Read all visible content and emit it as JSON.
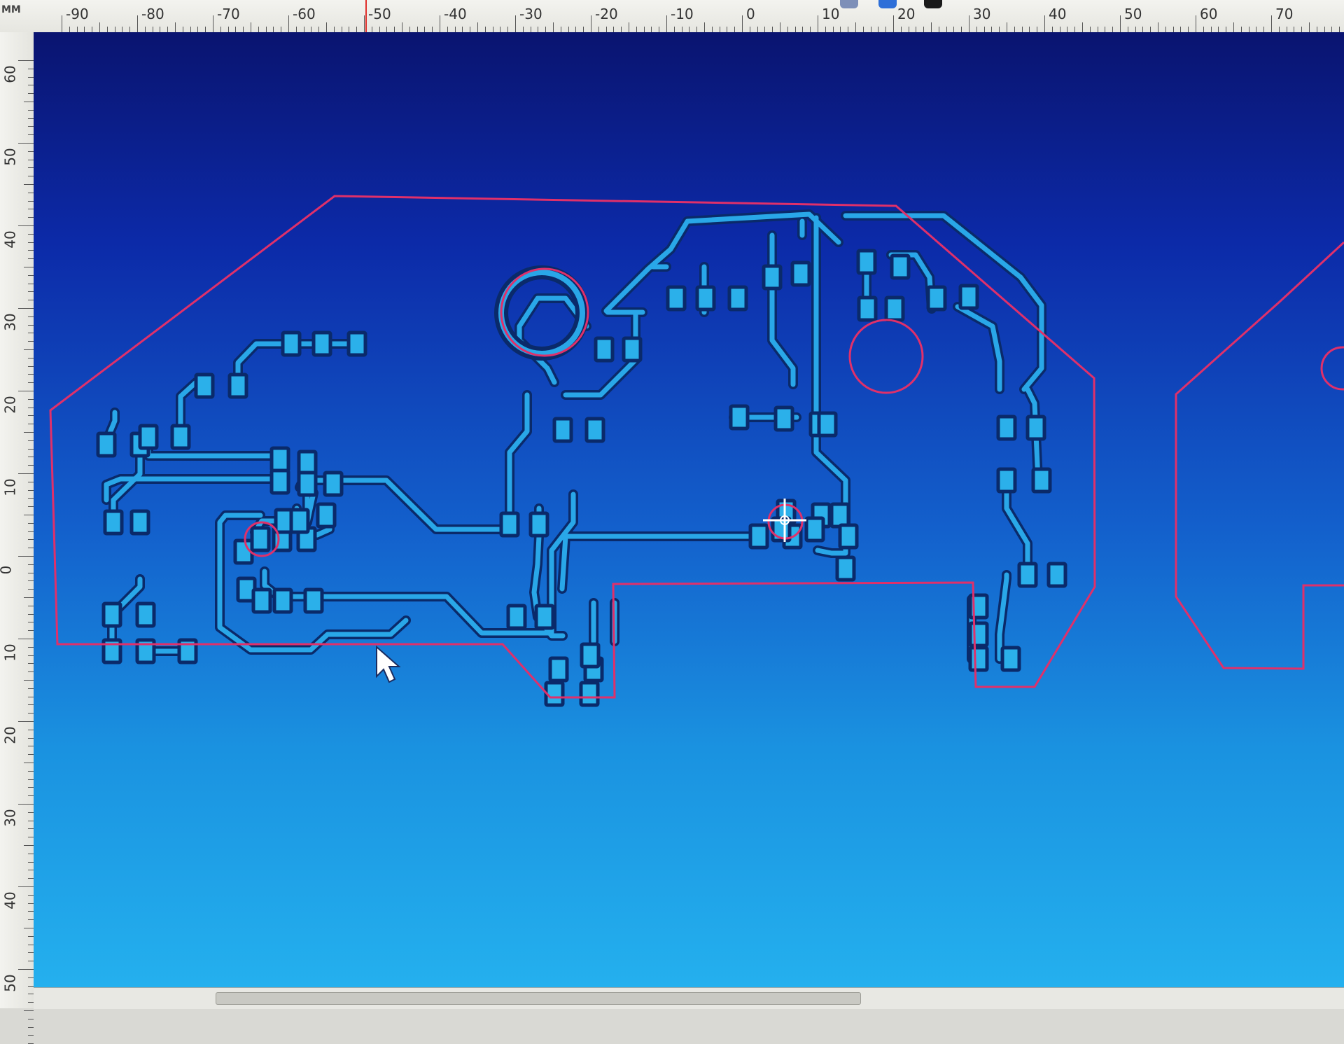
{
  "ruler": {
    "unit": "MM",
    "top_labels": [
      "-90",
      "-80",
      "-70",
      "-60",
      "-50",
      "-40",
      "-30",
      "-20",
      "-10",
      "0",
      "10",
      "20",
      "30",
      "40",
      "50",
      "60",
      "70"
    ],
    "left_labels": [
      "60",
      "50",
      "40",
      "30",
      "20",
      "10",
      "0",
      "10",
      "20",
      "30",
      "40",
      "50"
    ]
  },
  "colors": {
    "board_outline": "#e0306a",
    "trace_fill": "#29a7e8",
    "trace_clearance": "#0a2a6a",
    "pad_fill": "#2bb0ea",
    "canvas_top": "#0a1470",
    "canvas_bottom": "#24b0ee"
  },
  "icons": {
    "origin": "crosshair-icon",
    "pointer": "mouse-pointer-icon"
  }
}
